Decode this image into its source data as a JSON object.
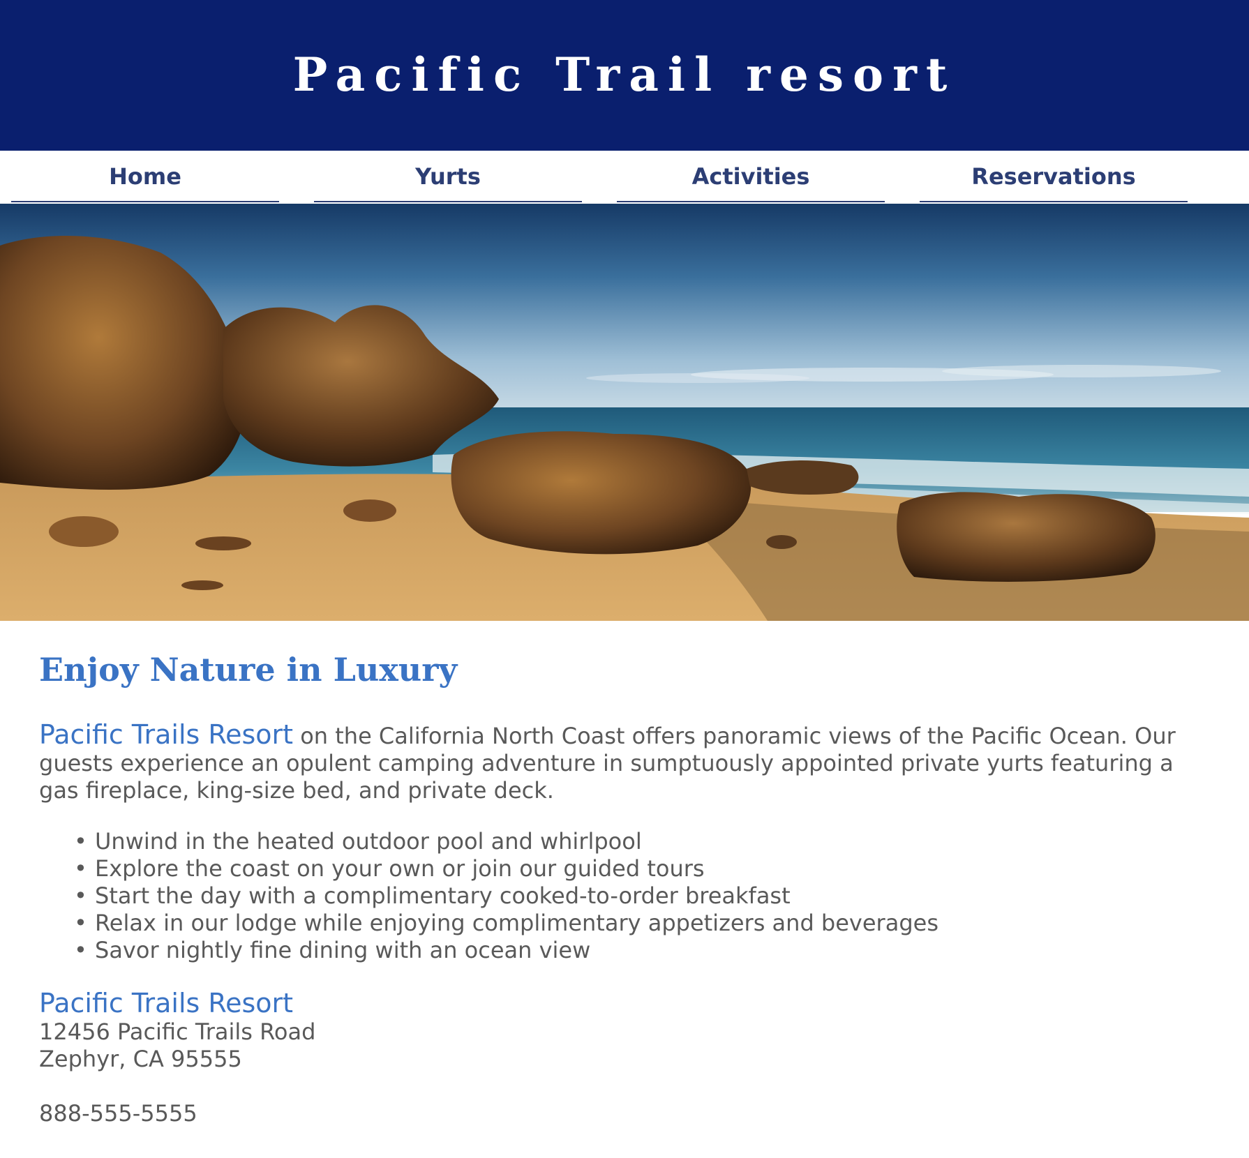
{
  "header": {
    "title": "Pacific Trail resort"
  },
  "nav": {
    "items": [
      {
        "label": "Home"
      },
      {
        "label": "Yurts"
      },
      {
        "label": "Activities"
      },
      {
        "label": "Reservations"
      }
    ]
  },
  "main": {
    "heading": "Enjoy Nature in Luxury",
    "intro_brand": "Pacific Trails Resort",
    "intro_text": " on the California North Coast offers panoramic views of the Pacific Ocean. Our guests experience an opulent camping adventure in sumptuously appointed private yurts featuring a gas fireplace, king-size bed, and private deck.",
    "features": [
      "Unwind in the heated outdoor pool and whirlpool",
      "Explore the coast on your own or join our guided tours",
      "Start the day with a complimentary cooked-to-order breakfast",
      "Relax in our lodge while enjoying complimentary appetizers and beverages",
      "Savor nightly fine dining with an ocean view"
    ]
  },
  "contact": {
    "name": "Pacific Trails Resort",
    "street": "12456 Pacific Trails Road",
    "city": "Zephyr, CA 95555",
    "phone": "888-555-5555"
  },
  "colors": {
    "banner": "#0a1f6e",
    "nav_text": "#2c3e74",
    "accent": "#3a73c4",
    "body_text": "#595959"
  }
}
